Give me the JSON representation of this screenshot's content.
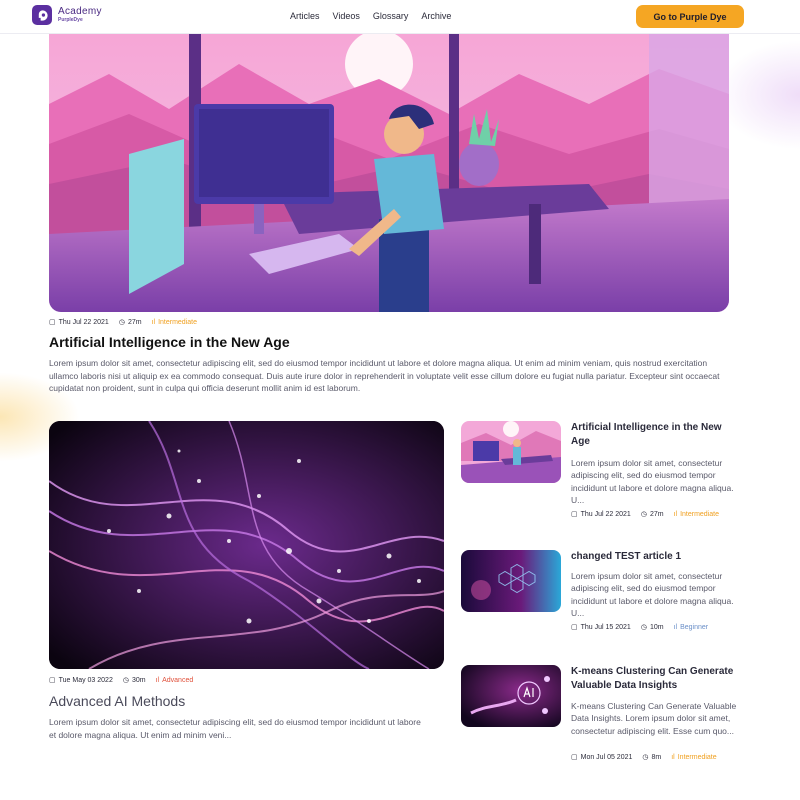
{
  "header": {
    "logo_name": "Academy",
    "logo_sub": "PurpleDye",
    "nav": [
      "Articles",
      "Videos",
      "Glossary",
      "Archive"
    ],
    "cta_label": "Go to Purple Dye"
  },
  "hero": {
    "date": "Thu Jul 22 2021",
    "duration": "27m",
    "level": "Intermediate",
    "title": "Artificial Intelligence in the New Age",
    "description": "Lorem ipsum dolor sit amet, consectetur adipiscing elit, sed do eiusmod tempor incididunt ut labore et dolore magna aliqua. Ut enim ad minim veniam, quis nostrud exercitation ullamco laboris nisi ut aliquip ex ea commodo consequat. Duis aute irure dolor in reprehenderit in voluptate velit esse cillum dolore eu fugiat nulla pariatur. Excepteur sint occaecat cupidatat non proident, sunt in culpa qui officia deserunt mollit anim id est laborum."
  },
  "feature": {
    "date": "Tue May 03 2022",
    "duration": "30m",
    "level": "Advanced",
    "title": "Advanced AI Methods",
    "description": "Lorem ipsum dolor sit amet, consectetur adipiscing elit, sed do eiusmod tempor incididunt ut labore et dolore magna aliqua. Ut enim ad minim veni..."
  },
  "side": [
    {
      "title": "Artificial Intelligence in the New Age",
      "description": "Lorem ipsum dolor sit amet, consectetur adipiscing elit, sed do eiusmod tempor incididunt ut labore et dolore magna aliqua. U...",
      "date": "Thu Jul 22 2021",
      "duration": "27m",
      "level": "Intermediate"
    },
    {
      "title": "changed TEST article 1",
      "description": "Lorem ipsum dolor sit amet, consectetur adipiscing elit, sed do eiusmod tempor incididunt ut labore et dolore magna aliqua. U...",
      "date": "Thu Jul 15 2021",
      "duration": "10m",
      "level": "Beginner"
    },
    {
      "title": "K-means Clustering Can Generate Valuable Data Insights",
      "description": "K-means Clustering Can Generate Valuable Data Insights. Lorem ipsum dolor sit amet, consectetur adipiscing elit. Esse cum quo...",
      "date": "Mon Jul 05 2021",
      "duration": "8m",
      "level": "Intermediate"
    }
  ],
  "colors": {
    "brand": "#5b2fa0",
    "cta": "#f5a623",
    "intermediate": "#f0a020",
    "advanced": "#e0503a",
    "beginner": "#6a8fc8"
  }
}
